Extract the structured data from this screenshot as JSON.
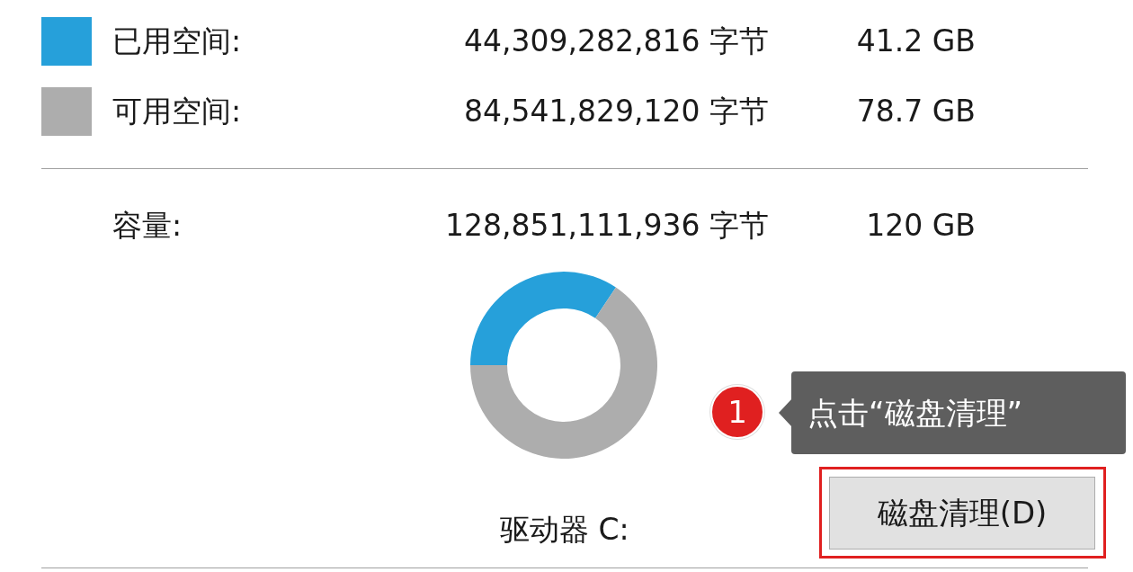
{
  "legend": [
    {
      "label": "已用空间:",
      "bytes": "44,309,282,816 字节",
      "size": "41.2 GB",
      "color": "#26a0da"
    },
    {
      "label": "可用空间:",
      "bytes": "84,541,829,120 字节",
      "size": "78.7 GB",
      "color": "#adadad"
    }
  ],
  "capacity": {
    "label": "容量:",
    "bytes": "128,851,111,936 字节",
    "size": "120 GB"
  },
  "chart_data": {
    "type": "donut",
    "values": [
      34.4,
      65.6
    ]
  },
  "drive_label": "驱动器 C:",
  "callout": {
    "number": "1",
    "text": "点击“磁盘清理”"
  },
  "button": {
    "label": "磁盘清理(D)",
    "highlighted": true
  }
}
